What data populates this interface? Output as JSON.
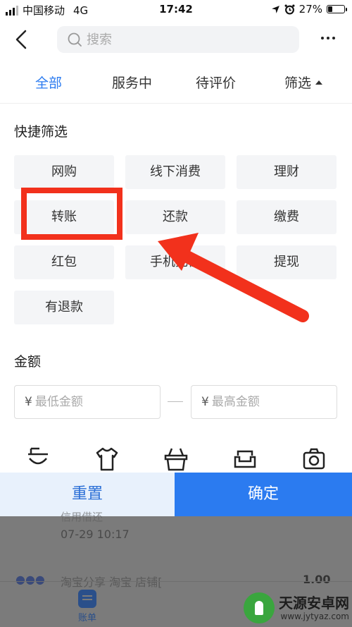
{
  "status_bar": {
    "carrier": "中国移动",
    "network": "4G",
    "time": "17:42",
    "battery": "27%",
    "battery_level": 0.27
  },
  "nav": {
    "search_placeholder": "搜索"
  },
  "tabs": [
    {
      "label": "全部",
      "active": true
    },
    {
      "label": "服务中",
      "active": false
    },
    {
      "label": "待评价",
      "active": false
    },
    {
      "label": "筛选",
      "active": false
    }
  ],
  "quick_filter": {
    "title": "快捷筛选",
    "chips": [
      "网购",
      "线下消费",
      "理财",
      "转账",
      "还款",
      "缴费",
      "红包",
      "手机充值",
      "提现",
      "有退款"
    ]
  },
  "amount": {
    "title": "金额",
    "currency_symbol": "¥",
    "min_placeholder": "最低金额",
    "max_placeholder": "最高金额"
  },
  "categories": [
    "food-icon",
    "clothing-icon",
    "shopping-basket-icon",
    "sofa-icon",
    "camera-icon"
  ],
  "buttons": {
    "reset": "重置",
    "confirm": "确定"
  },
  "underlying": {
    "record_title": "信用借还",
    "record_time": "07-29  10:17",
    "record_row2": "淘宝分享 淘宝 店铺[",
    "record_amount": "1.00",
    "bottom_tab_label": "账单"
  },
  "watermark": {
    "name": "天源安卓网",
    "url": "www.jytyaz.com"
  },
  "colors": {
    "accent": "#2b7bf0",
    "annotation": "#f2311c"
  }
}
